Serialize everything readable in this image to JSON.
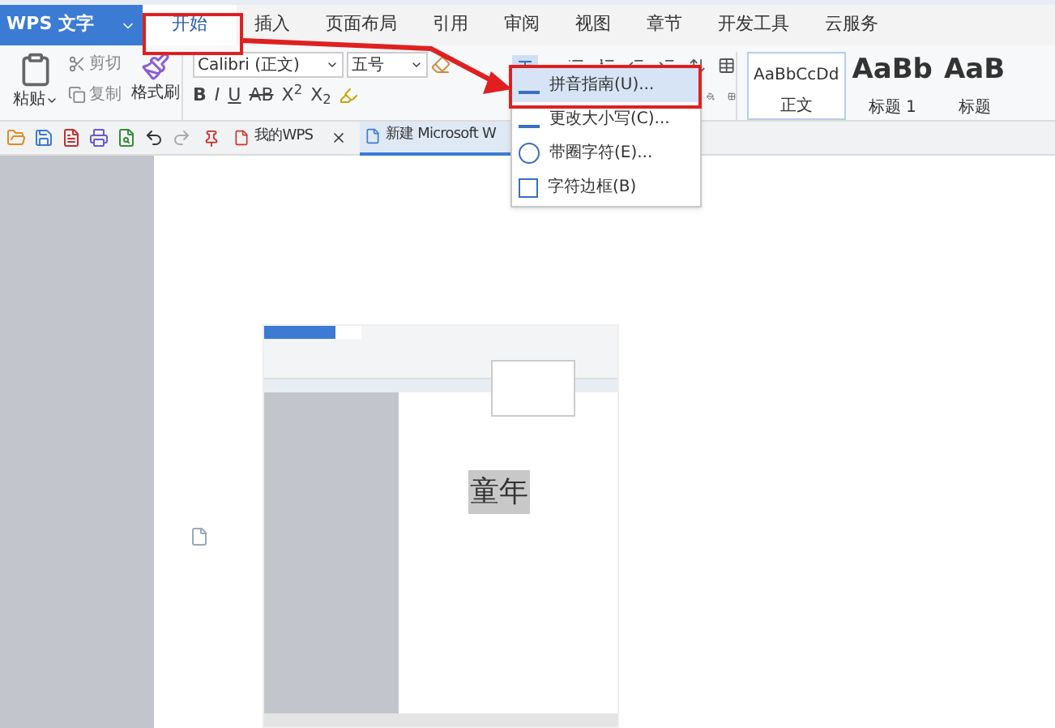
{
  "app_button": {
    "label": "WPS 文字"
  },
  "tabs": [
    {
      "label": "开始",
      "selected": true
    },
    {
      "label": "插入",
      "selected": false
    },
    {
      "label": "页面布局",
      "selected": false
    },
    {
      "label": "引用",
      "selected": false
    },
    {
      "label": "审阅",
      "selected": false
    },
    {
      "label": "视图",
      "selected": false
    },
    {
      "label": "章节",
      "selected": false
    },
    {
      "label": "开发工具",
      "selected": false
    },
    {
      "label": "云服务",
      "selected": false
    }
  ],
  "clipboard": {
    "paste": "粘贴",
    "cut": "剪切",
    "copy": "复制",
    "format_painter": "格式刷"
  },
  "font": {
    "name": "Calibri (正文)",
    "size": "五号"
  },
  "format_buttons": [
    {
      "label": "B",
      "kind": "bold"
    },
    {
      "label": "I",
      "kind": "italic"
    },
    {
      "label": "U",
      "kind": "underline"
    },
    {
      "label": "AB",
      "kind": "strike"
    },
    {
      "label": "X$^{2}$",
      "kind": "plain"
    },
    {
      "label": "X$_{2}$",
      "kind": "plain"
    }
  ],
  "styles": [
    {
      "sample": "AaBbCcDd",
      "name": "正文",
      "selected": true
    },
    {
      "sample": "AaBb",
      "name": "标题 1",
      "selected": false
    },
    {
      "sample": "AaB",
      "name": "标题",
      "selected": false
    }
  ],
  "doc_tabs": [
    {
      "label": "我的WPS",
      "selected": false
    },
    {
      "label": "新建 Microsoft W",
      "selected": true
    }
  ],
  "dropdown_menu": [
    {
      "label": "拼音指南(U)...",
      "selected": true
    },
    {
      "label": "更改大小写(C)...",
      "selected": false
    },
    {
      "label": "带圈字符(E)...",
      "selected": false
    },
    {
      "label": "字符边框(B)",
      "selected": false
    }
  ],
  "embedded_screenshot": {
    "text": "童年"
  }
}
